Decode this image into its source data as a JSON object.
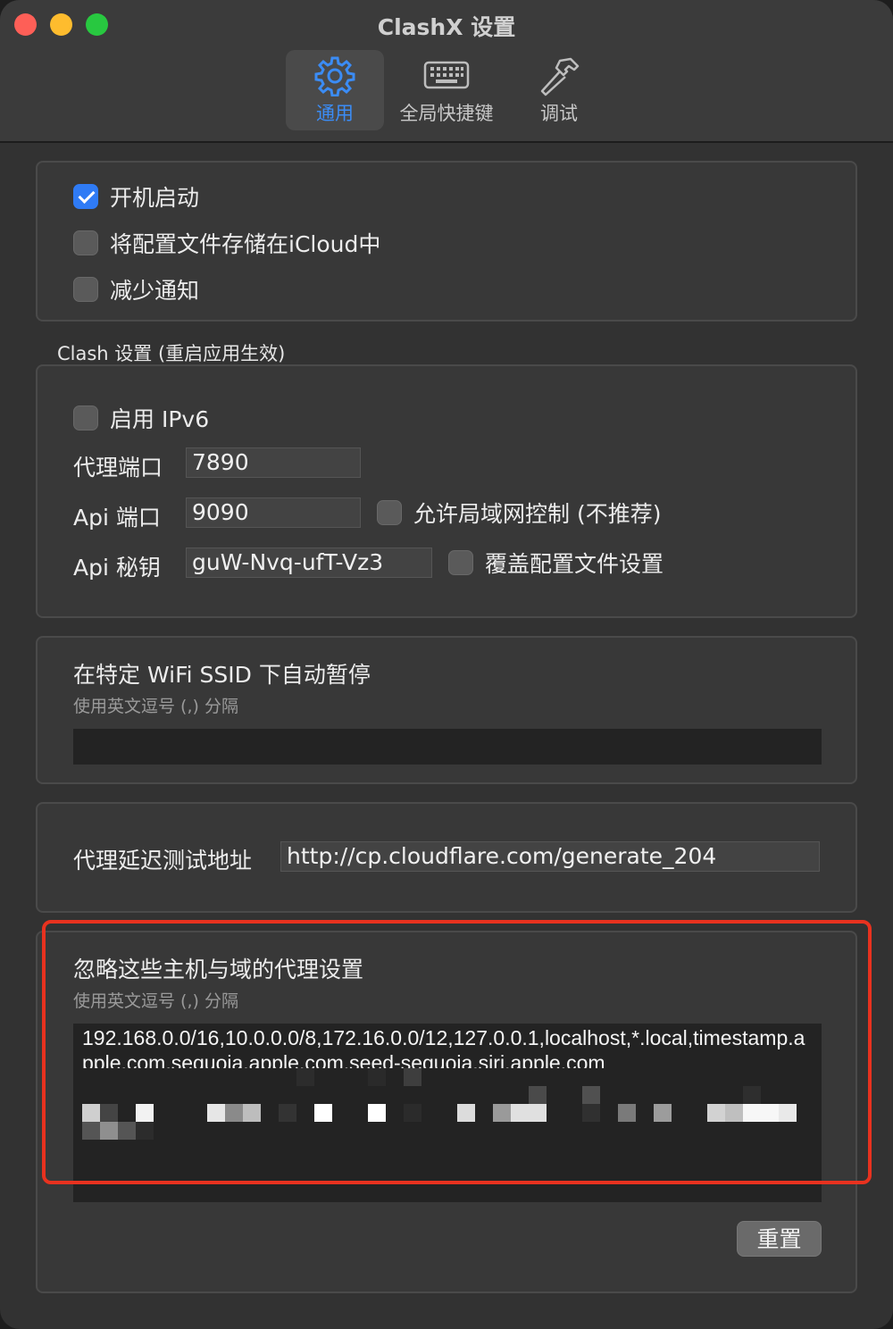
{
  "window": {
    "title": "ClashX 设置"
  },
  "tabs": [
    {
      "label": "通用",
      "icon": "gear-icon",
      "active": true
    },
    {
      "label": "全局快捷键",
      "icon": "keyboard-icon",
      "active": false
    },
    {
      "label": "调试",
      "icon": "hammer-icon",
      "active": false
    }
  ],
  "general": {
    "launch_at_login": {
      "label": "开机启动",
      "checked": true
    },
    "icloud_config": {
      "label": "将配置文件存储在iCloud中",
      "checked": false
    },
    "reduce_notifications": {
      "label": "减少通知",
      "checked": false
    }
  },
  "clash_settings": {
    "section_title": "Clash 设置 (重启应用生效)",
    "ipv6": {
      "label": "启用 IPv6",
      "checked": false
    },
    "proxy_port": {
      "label": "代理端口",
      "value": "7890"
    },
    "api_port": {
      "label": "Api 端口",
      "value": "9090"
    },
    "allow_lan": {
      "label": "允许局域网控制 (不推荐)",
      "checked": false
    },
    "api_secret": {
      "label": "Api 秘钥",
      "value": "guW-Nvq-ufT-Vz3"
    },
    "override_config": {
      "label": "覆盖配置文件设置",
      "checked": false
    }
  },
  "wifi_pause": {
    "title": "在特定 WiFi SSID 下自动暂停",
    "hint": "使用英文逗号 (,) 分隔",
    "value": ""
  },
  "latency_test": {
    "label": "代理延迟测试地址",
    "value": "http://cp.cloudflare.com/generate_204"
  },
  "bypass": {
    "title": "忽略这些主机与域的代理设置",
    "hint": "使用英文逗号 (,) 分隔",
    "value": "192.168.0.0/16,10.0.0.0/8,172.16.0.0/12,127.0.0.1,localhost,*.local,timestamp.apple.com,sequoia.apple.com,seed-sequoia.siri.apple.com"
  },
  "buttons": {
    "reset": "重置"
  },
  "colors": {
    "accent": "#2f7bf5",
    "highlight": "#e8321f"
  }
}
